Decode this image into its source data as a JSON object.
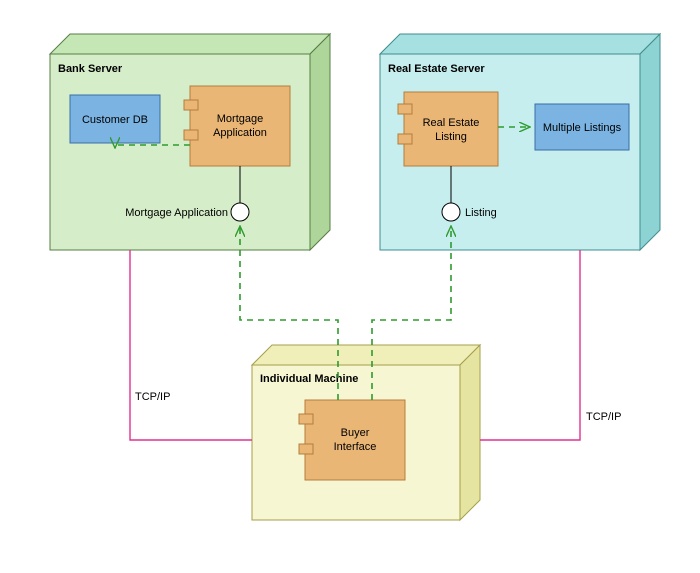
{
  "nodes": {
    "bankServer": {
      "title": "Bank Server"
    },
    "realEstateServer": {
      "title": "Real Estate Server"
    },
    "individualMachine": {
      "title": "Individual Machine"
    },
    "customerDB": {
      "label": "Customer DB"
    },
    "mortgageApp": {
      "label1": "Mortgage",
      "label2": "Application"
    },
    "realEstateListing": {
      "label1": "Real Estate",
      "label2": "Listing"
    },
    "multipleListings": {
      "label": "Multiple Listings"
    },
    "buyerInterface": {
      "label1": "Buyer",
      "label2": "Interface"
    }
  },
  "ports": {
    "mortgagePort": "Mortgage Application",
    "listingPort": "Listing"
  },
  "links": {
    "leftTcp": "TCP/IP",
    "rightTcp": "TCP/IP"
  },
  "chart_data": {
    "type": "uml-deployment",
    "nodes": [
      {
        "id": "BankServer",
        "type": "node",
        "label": "Bank Server",
        "children": [
          {
            "id": "CustomerDB",
            "type": "artifact",
            "label": "Customer DB"
          },
          {
            "id": "MortgageApplication",
            "type": "component",
            "label": "Mortgage Application",
            "providedInterfaces": [
              "Mortgage Application"
            ]
          }
        ]
      },
      {
        "id": "RealEstateServer",
        "type": "node",
        "label": "Real Estate Server",
        "children": [
          {
            "id": "RealEstateListing",
            "type": "component",
            "label": "Real Estate Listing",
            "providedInterfaces": [
              "Listing"
            ]
          },
          {
            "id": "MultipleListings",
            "type": "artifact",
            "label": "Multiple Listings"
          }
        ]
      },
      {
        "id": "IndividualMachine",
        "type": "node",
        "label": "Individual Machine",
        "children": [
          {
            "id": "BuyerInterface",
            "type": "component",
            "label": "Buyer Interface"
          }
        ]
      }
    ],
    "edges": [
      {
        "from": "MortgageApplication",
        "to": "CustomerDB",
        "style": "dependency",
        "arrow": "open"
      },
      {
        "from": "RealEstateListing",
        "to": "MultipleListings",
        "style": "dependency",
        "arrow": "open"
      },
      {
        "from": "BuyerInterface",
        "to": "MortgageApplication.providedInterface",
        "style": "dependency",
        "arrow": "open"
      },
      {
        "from": "BuyerInterface",
        "to": "RealEstateListing.providedInterface",
        "style": "dependency",
        "arrow": "open"
      },
      {
        "from": "IndividualMachine",
        "to": "BankServer",
        "style": "association",
        "label": "TCP/IP"
      },
      {
        "from": "IndividualMachine",
        "to": "RealEstateServer",
        "style": "association",
        "label": "TCP/IP"
      }
    ]
  }
}
